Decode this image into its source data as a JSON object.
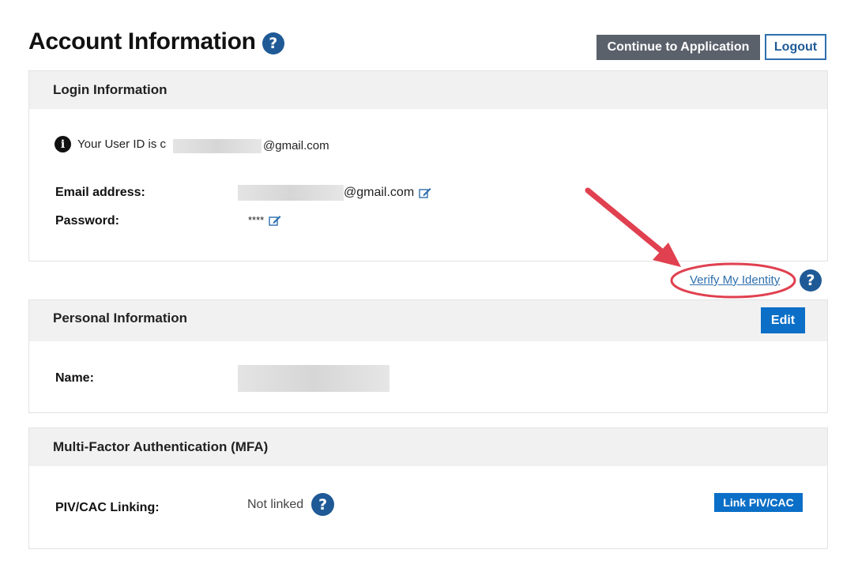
{
  "header": {
    "title": "Account Information",
    "help_glyph": "?",
    "continue_label": "Continue to Application",
    "logout_label": "Logout"
  },
  "login": {
    "heading": "Login Information",
    "info_icon": "info-circle-icon",
    "user_id_prefix": "Your User ID is c",
    "user_id_suffix": "@gmail.com",
    "email_label": "Email address:",
    "email_suffix": "@gmail.com",
    "password_label": "Password:",
    "password_value": "****"
  },
  "verify": {
    "link_label": "Verify My Identity",
    "help_glyph": "?"
  },
  "personal": {
    "heading": "Personal Information",
    "edit_label": "Edit",
    "name_label": "Name:"
  },
  "mfa": {
    "heading": "Multi-Factor Authentication (MFA)",
    "piv_label": "PIV/CAC Linking:",
    "piv_status": "Not linked",
    "help_glyph": "?",
    "link_button_label": "Link PIV/CAC"
  },
  "colors": {
    "primary_blue": "#0b6fc7",
    "dark_blue": "#1f5a96",
    "gray_button": "#5b616b",
    "annotation_red": "#e0404f"
  }
}
